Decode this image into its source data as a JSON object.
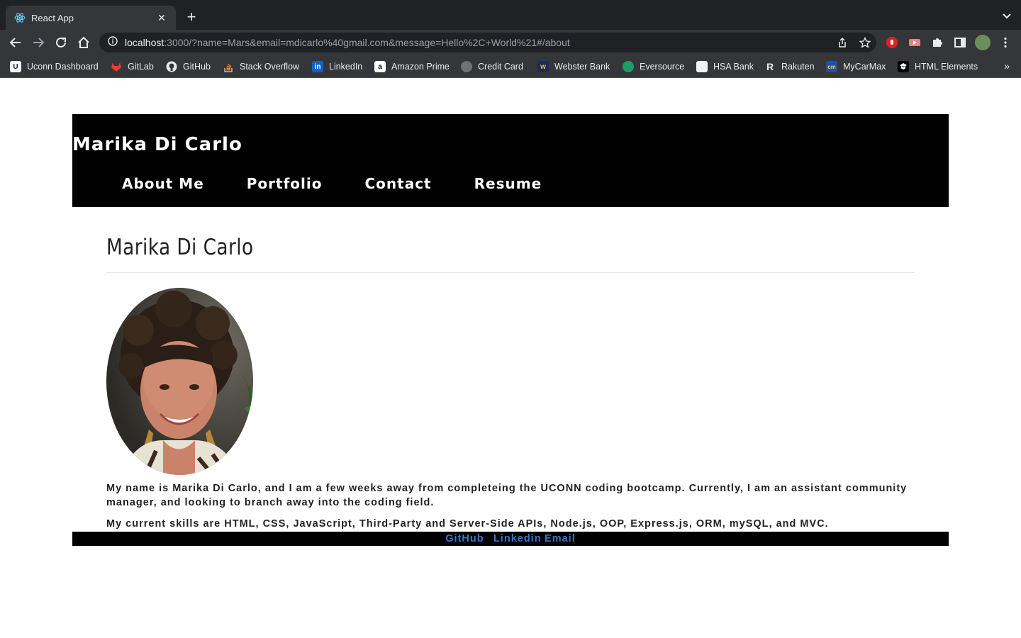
{
  "browser": {
    "tab_title": "React App",
    "url_host": "localhost",
    "url_rest": ":3000/?name=Mars&email=mdicarlo%40gmail.com&message=Hello%2C+World%21#/about",
    "bookmarks": [
      {
        "label": "Uconn Dashboard",
        "icon": "uconn-icon"
      },
      {
        "label": "GitLab",
        "icon": "gitlab-icon"
      },
      {
        "label": "GitHub",
        "icon": "github-icon"
      },
      {
        "label": "Stack Overflow",
        "icon": "stackoverflow-icon"
      },
      {
        "label": "LinkedIn",
        "icon": "linkedin-icon"
      },
      {
        "label": "Amazon Prime",
        "icon": "amazon-icon"
      },
      {
        "label": "Credit Card",
        "icon": "globe-icon"
      },
      {
        "label": "Webster Bank",
        "icon": "webster-icon"
      },
      {
        "label": "Eversource",
        "icon": "eversource-icon"
      },
      {
        "label": "HSA Bank",
        "icon": "hsa-icon"
      },
      {
        "label": "Rakuten",
        "icon": "rakuten-icon"
      },
      {
        "label": "MyCarMax",
        "icon": "carmax-icon"
      },
      {
        "label": "HTML Elements",
        "icon": "html-icon"
      }
    ],
    "more_label": "»"
  },
  "site": {
    "title": "Marika Di Carlo",
    "nav": [
      "About Me",
      "Portfolio",
      "Contact",
      "Resume"
    ]
  },
  "about": {
    "heading": "Marika Di Carlo",
    "bio": "My name is Marika Di Carlo, and I am a few weeks away from completeing the UCONN coding bootcamp. Currently, I am an assistant community manager, and looking to branch away into the coding field.",
    "skills": "My current skills are HTML, CSS, JavaScript, Third-Party and Server-Side APIs, Node.js, OOP, Express.js, ORM, mySQL, and MVC."
  },
  "footer": {
    "links": [
      "GitHub",
      "Linkedin",
      "Email"
    ]
  },
  "colors": {
    "chrome_dark": "#202124",
    "chrome_toolbar": "#35363a",
    "header_bg": "#000000",
    "footer_link": "#3a78c9"
  }
}
